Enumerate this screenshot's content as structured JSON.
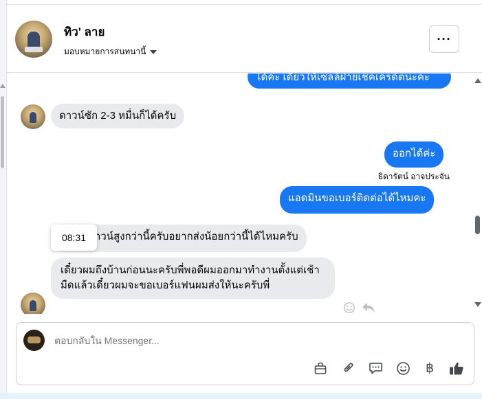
{
  "header": {
    "page_name": "ทิว' ลาย",
    "assign_label": "มอบหมายการสนทนานี้",
    "more_label": "···"
  },
  "messages": {
    "top_partial": "ได้ค่ะ เดี๋ยวให้เซลล์ฝ่ายเช็คเครดิตนะคะ",
    "m1": "ดาวน์ซัก 2-3 หมื่นก็ได้ครับ",
    "m2": "ออกได้ค่ะ",
    "m2_sender": "ธิดารัตน์ อาจประจัน",
    "m3": "แอดมินขอเบอร์ติดต่อได้ไหมคะ",
    "m4": "าวน์สูงกว่านี้ครับอยากส่งน้อยกว่านี้ได้ไหมครับ",
    "m5": "เดี๋ยวผมถึงบ้านก่อนนะครับพี่พอดีผมออกมาทำงานตั้งแต่เช้ามืดแล้วเดี๋ยวผมจะขอเบอร์แฟนผมส่งให้นะครับพี่",
    "tooltip_time": "08:31"
  },
  "composer": {
    "placeholder": "ตอบกลับใน Messenger...",
    "baht_symbol": "฿"
  },
  "icons": {
    "more": "more-horizontal-icon",
    "react": "smiley-icon",
    "reply": "reply-icon",
    "tools": [
      "bag-icon",
      "paperclip-icon",
      "saved-reply-icon",
      "emoji-icon",
      "baht-icon",
      "thumbs-up-icon"
    ]
  },
  "colors": {
    "outgoing_bubble": "#1877f2",
    "incoming_bubble": "#e9eaed",
    "text": "#050505",
    "muted": "#65676b"
  }
}
